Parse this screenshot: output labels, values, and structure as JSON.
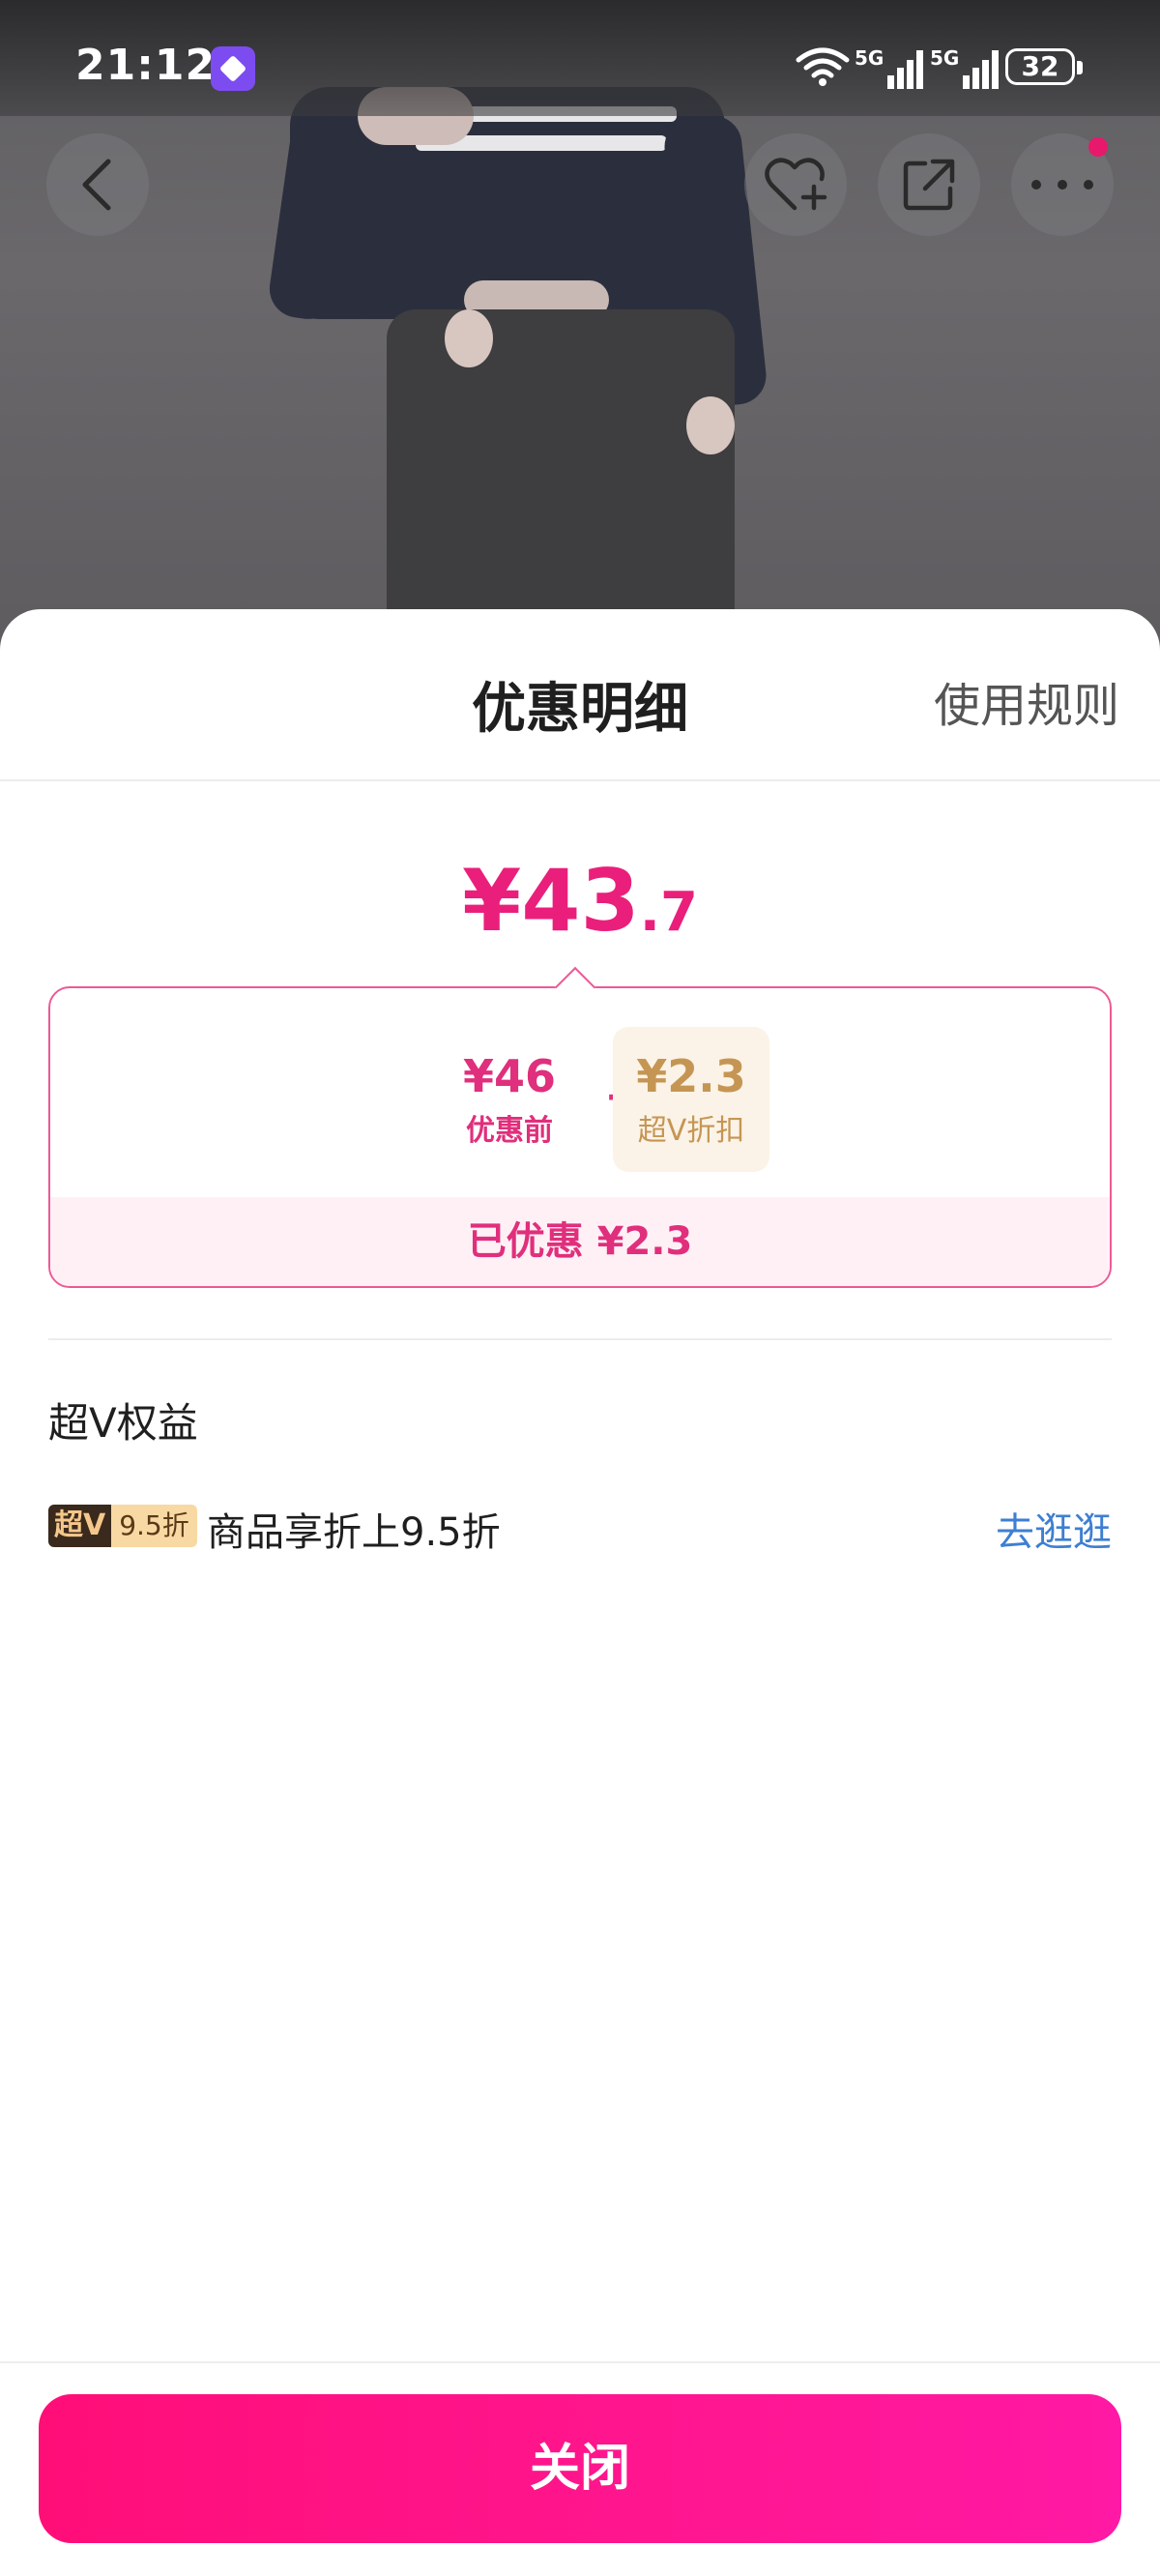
{
  "status_bar": {
    "time": "21:12",
    "signal_1_label": "5G",
    "signal_2_label": "5G",
    "battery": "32"
  },
  "nav": {
    "back_icon": "back-arrow-icon",
    "favorite_icon": "heart-plus-icon",
    "share_icon": "share-icon",
    "more_icon": "more-icon"
  },
  "sheet": {
    "title": "优惠明细",
    "rules_link": "使用规则",
    "final_price": {
      "currency_main": "¥43",
      "decimal": ".7"
    },
    "breakdown": {
      "original_amount": "¥46",
      "original_label": "优惠前",
      "operator": "-",
      "discount_amount": "¥2.3",
      "discount_label": "超V折扣",
      "saved_text": "已优惠 ¥2.3"
    },
    "benefits": {
      "title": "超V权益",
      "items": [
        {
          "badge_left": "超V",
          "badge_right": "9.5折",
          "text": "商品享折上9.5折",
          "link": "去逛逛"
        }
      ]
    },
    "close_button": "关闭"
  },
  "colors": {
    "accent": "#ea1f7b",
    "link": "#3e7fd2",
    "discount_gold": "#c59653"
  }
}
